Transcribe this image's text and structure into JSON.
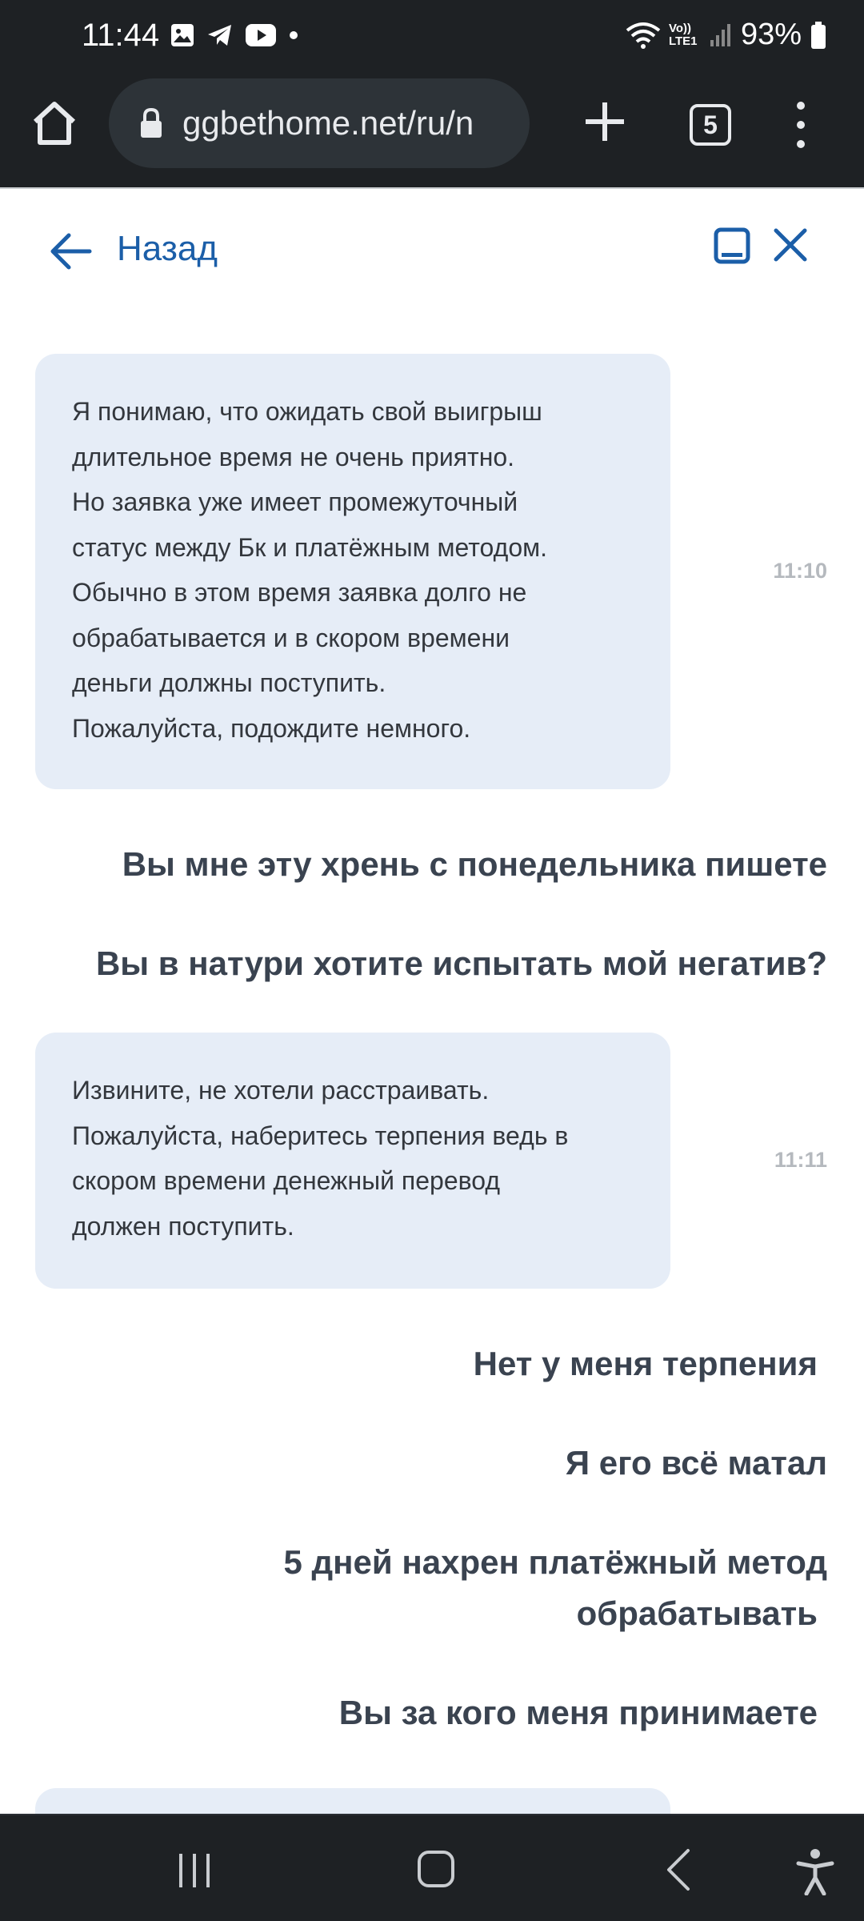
{
  "status_bar": {
    "time": "11:44",
    "network_label": "Vo)) LTE1",
    "battery": "93%"
  },
  "browser": {
    "url": "ggbethome.net/ru/n",
    "tab_count": "5"
  },
  "chat_header": {
    "back_label": "Назад"
  },
  "messages": [
    {
      "type": "support",
      "lines": [
        "Я понимаю, что ожидать свой выигрыш",
        "длительное время не очень приятно.",
        "Но заявка уже имеет промежуточный",
        "статус между Бк и платёжным методом.",
        "Обычно в этом время заявка долго не",
        "обрабатывается и в скором времени",
        "деньги должны поступить.",
        "Пожалуйста, подождите немного."
      ],
      "time": "11:10"
    },
    {
      "type": "user",
      "text": "Вы мне эту хрень с понедельника пишете"
    },
    {
      "type": "user",
      "text": "Вы в натури хотите испытать мой негатив?"
    },
    {
      "type": "support",
      "lines": [
        "Извините, не хотели расстраивать.",
        "Пожалуйста, наберитесь терпения ведь в",
        "скором времени денежный перевод",
        "должен поступить."
      ],
      "time": "11:11"
    },
    {
      "type": "user",
      "text": "Нет у меня терпения"
    },
    {
      "type": "user",
      "text": "Я его всё матал"
    },
    {
      "type": "user",
      "lines": [
        "5 дней нахрен платёжный метод",
        "обрабатывать"
      ]
    },
    {
      "type": "user",
      "text": "Вы за кого меня принимаете"
    }
  ]
}
